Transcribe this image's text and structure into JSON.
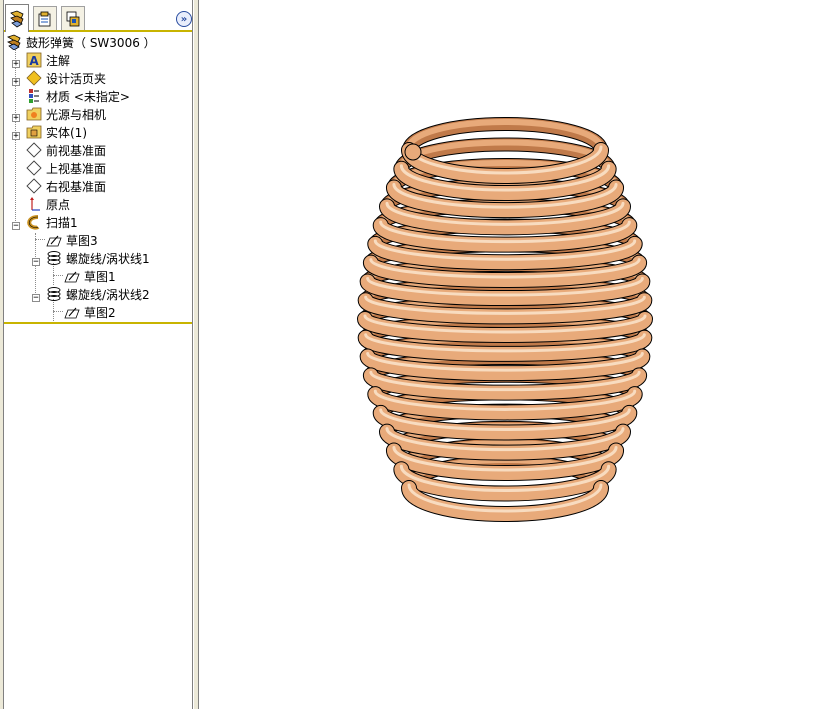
{
  "tabs": [
    {
      "name": "feature-manager",
      "icon": "feature-tree-icon",
      "active": true
    },
    {
      "name": "property-manager",
      "icon": "property-sheet-icon",
      "active": false
    },
    {
      "name": "configuration-manager",
      "icon": "configuration-icon",
      "active": false
    }
  ],
  "expand_button": {
    "icon": "double-chevron-right-icon"
  },
  "tree": {
    "root": "鼓形弹簧（ SW3006 ）",
    "annotations": "注解",
    "design_binder": "设计活页夹",
    "material": "材质 <未指定>",
    "lights_cameras": "光源与相机",
    "solid_bodies": "实体(1)",
    "front_plane": "前视基准面",
    "top_plane": "上视基准面",
    "right_plane": "右视基准面",
    "origin": "原点",
    "sweep": "扫描1",
    "sketch3": "草图3",
    "helix1": "螺旋线/涡状线1",
    "sketch1": "草图1",
    "helix2": "螺旋线/涡状线2",
    "sketch2": "草图2"
  },
  "model": {
    "coil_color": "#e8aa7a",
    "coil_shadow": "#c07a4a",
    "coil_highlight": "#f8dcc0",
    "turns": 19
  }
}
